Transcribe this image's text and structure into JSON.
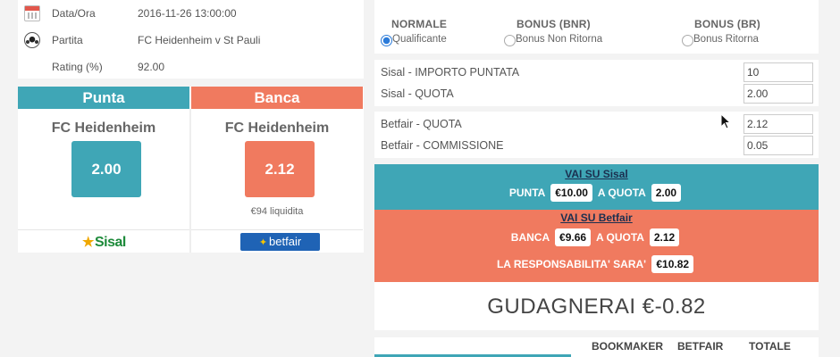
{
  "match_info": {
    "date_label": "Data/Ora",
    "date_value": "2016-11-26 13:00:00",
    "match_label": "Partita",
    "match_value": "FC Heidenheim v St Pauli",
    "rating_label": "Rating (%)",
    "rating_value": "92.00"
  },
  "punta": {
    "header": "Punta",
    "team": "FC Heidenheim",
    "odd": "2.00",
    "bookmaker": "Sisal"
  },
  "banca": {
    "header": "Banca",
    "team": "FC Heidenheim",
    "odd": "2.12",
    "liquidity": "€94 liquidita",
    "exchange": "betfair"
  },
  "modes": [
    {
      "title": "NORMALE",
      "option": "Qualificante",
      "selected": true
    },
    {
      "title": "BONUS (BNR)",
      "option": "Bonus Non Ritorna",
      "selected": false
    },
    {
      "title": "BONUS (BR)",
      "option": "Bonus Ritorna",
      "selected": false
    }
  ],
  "sisal_params": {
    "stake_label": "Sisal - IMPORTO PUNTATA",
    "stake_value": "10",
    "odd_label": "Sisal - QUOTA",
    "odd_value": "2.00"
  },
  "betfair_params": {
    "odd_label": "Betfair - QUOTA",
    "odd_value": "2.12",
    "commission_label": "Betfair - COMMISSIONE",
    "commission_value": "0.05"
  },
  "sisal_instruction": {
    "link": "VAI SU Sisal",
    "action": "PUNTA",
    "amount": "€10.00",
    "at_odds": "A QUOTA",
    "odds": "2.00"
  },
  "betfair_instruction": {
    "link": "VAI SU Betfair",
    "action": "BANCA",
    "amount": "€9.66",
    "at_odds": "A QUOTA",
    "odds": "2.12",
    "liability_label": "LA RESPONSABILITA' SARA'",
    "liability": "€10.82"
  },
  "result": {
    "text": "GUDAGNERAI €-0.82"
  },
  "table": {
    "headers": [
      "BOOKMAKER",
      "BETFAIR",
      "TOTALE"
    ]
  },
  "colors": {
    "punta": "#3fa6b6",
    "banca": "#f07a5f",
    "radio_selected": "#2b7bd9"
  }
}
